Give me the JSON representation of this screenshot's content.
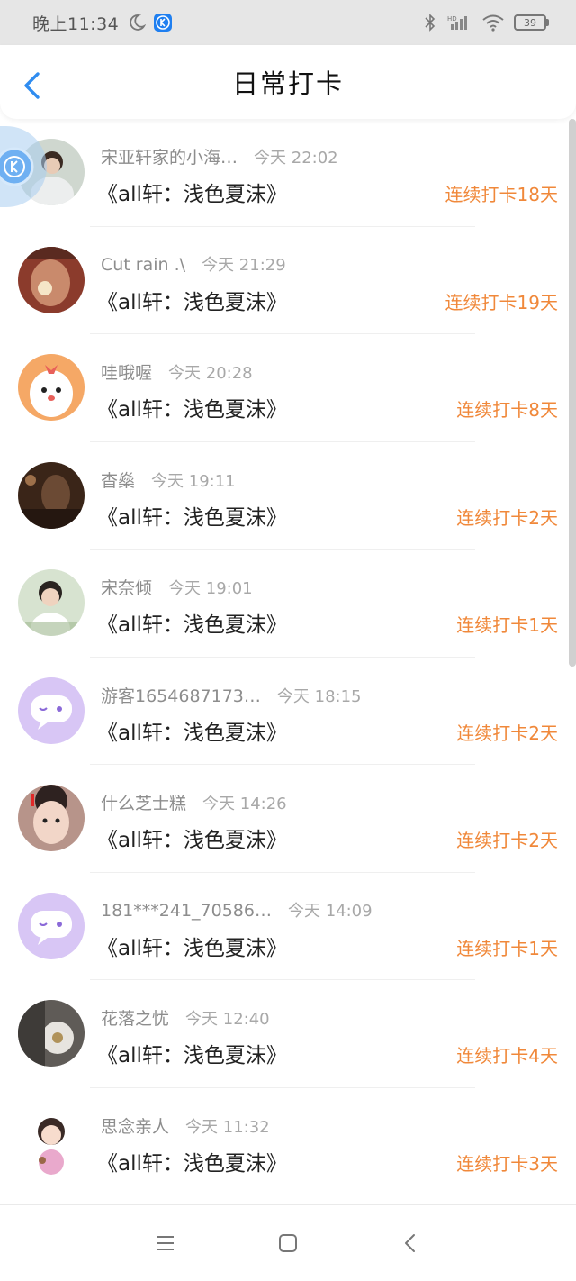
{
  "status_bar": {
    "time": "晚上11:34",
    "battery": "39",
    "hd_label": "HD"
  },
  "header": {
    "title": "日常打卡"
  },
  "items": [
    {
      "name": "宋亚轩家的小海…",
      "time": "今天 22:02",
      "book": "《all轩：浅色夏沫》",
      "streak": "连续打卡18天",
      "avatar_color": "#cfd7cf"
    },
    {
      "name": "Cut rain .\\",
      "time": "今天 21:29",
      "book": "《all轩：浅色夏沫》",
      "streak": "连续打卡19天",
      "avatar_color": "#8b3b2c"
    },
    {
      "name": "哇哦喔",
      "time": "今天 20:28",
      "book": "《all轩：浅色夏沫》",
      "streak": "连续打卡8天",
      "avatar_color": "#f5a866"
    },
    {
      "name": "杳燊",
      "time": "今天 19:11",
      "book": "《all轩：浅色夏沫》",
      "streak": "连续打卡2天",
      "avatar_color": "#4a3020"
    },
    {
      "name": "宋奈倾",
      "time": "今天 19:01",
      "book": "《all轩：浅色夏沫》",
      "streak": "连续打卡1天",
      "avatar_color": "#c9d9c2"
    },
    {
      "name": "游客1654687173…",
      "time": "今天 18:15",
      "book": "《all轩：浅色夏沫》",
      "streak": "连续打卡2天",
      "avatar_color": "#d8c6f5"
    },
    {
      "name": "什么芝士糕",
      "time": "今天 14:26",
      "book": "《all轩：浅色夏沫》",
      "streak": "连续打卡2天",
      "avatar_color": "#c79e8a"
    },
    {
      "name": "181***241_70586…",
      "time": "今天 14:09",
      "book": "《all轩：浅色夏沫》",
      "streak": "连续打卡1天",
      "avatar_color": "#d8c6f5"
    },
    {
      "name": "花落之忧",
      "time": "今天 12:40",
      "book": "《all轩：浅色夏沫》",
      "streak": "连续打卡4天",
      "avatar_color": "#6d6a66"
    },
    {
      "name": "思念亲人",
      "time": "今天 11:32",
      "book": "《all轩：浅色夏沫》",
      "streak": "连续打卡3天",
      "avatar_color": "#f3eef0"
    }
  ],
  "colors": {
    "accent": "#f0883a",
    "back_icon": "#2f8cf0"
  },
  "icons": {
    "back": "chevron-left-icon",
    "nav": [
      "menu-icon",
      "home-square-icon",
      "back-triangle-icon"
    ]
  }
}
